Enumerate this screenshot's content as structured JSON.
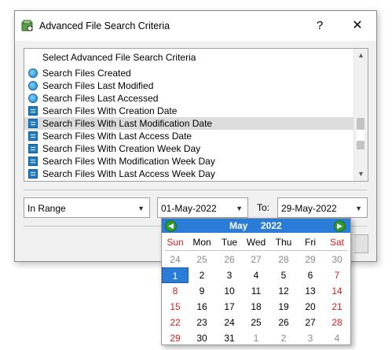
{
  "window": {
    "title": "Advanced File Search Criteria",
    "help_label": "?",
    "close_label": "✕"
  },
  "list": {
    "header": "Select Advanced File Search Criteria",
    "items": [
      {
        "label": "Search Files Created",
        "icon": "clock-icon"
      },
      {
        "label": "Search Files Last Modified",
        "icon": "clock-icon"
      },
      {
        "label": "Search Files Last Accessed",
        "icon": "clock-icon"
      },
      {
        "label": "Search Files With Creation Date",
        "icon": "calendar-grid-icon"
      },
      {
        "label": "Search Files With Last Modification Date",
        "icon": "calendar-grid-icon",
        "selected": true
      },
      {
        "label": "Search Files With Last Access Date",
        "icon": "calendar-grid-icon"
      },
      {
        "label": "Search Files With Creation Week Day",
        "icon": "calendar-grid-icon"
      },
      {
        "label": "Search Files With Modification Week Day",
        "icon": "calendar-grid-icon"
      },
      {
        "label": "Search Files With Last Access Week Day",
        "icon": "calendar-grid-icon"
      }
    ]
  },
  "filters": {
    "range_value": "In Range",
    "from_date": "01-May-2022",
    "to_label": "To:",
    "to_date": "29-May-2022"
  },
  "calendar": {
    "month": "May",
    "year": "2022",
    "prev_label": "◀",
    "next_label": "▶",
    "weekdays": [
      "Sun",
      "Mon",
      "Tue",
      "Wed",
      "Thu",
      "Fri",
      "Sat"
    ],
    "weeks": [
      [
        "24",
        "25",
        "26",
        "27",
        "28",
        "29",
        "30"
      ],
      [
        "1",
        "2",
        "3",
        "4",
        "5",
        "6",
        "7"
      ],
      [
        "8",
        "9",
        "10",
        "11",
        "12",
        "13",
        "14"
      ],
      [
        "15",
        "16",
        "17",
        "18",
        "19",
        "20",
        "21"
      ],
      [
        "22",
        "23",
        "24",
        "25",
        "26",
        "27",
        "28"
      ],
      [
        "29",
        "30",
        "31",
        "1",
        "2",
        "3",
        "4"
      ]
    ],
    "selected_day": "1",
    "colors": {
      "header": "#2b7cd6",
      "weekend": "#d42020",
      "other_month": "#8a8a8a"
    }
  }
}
